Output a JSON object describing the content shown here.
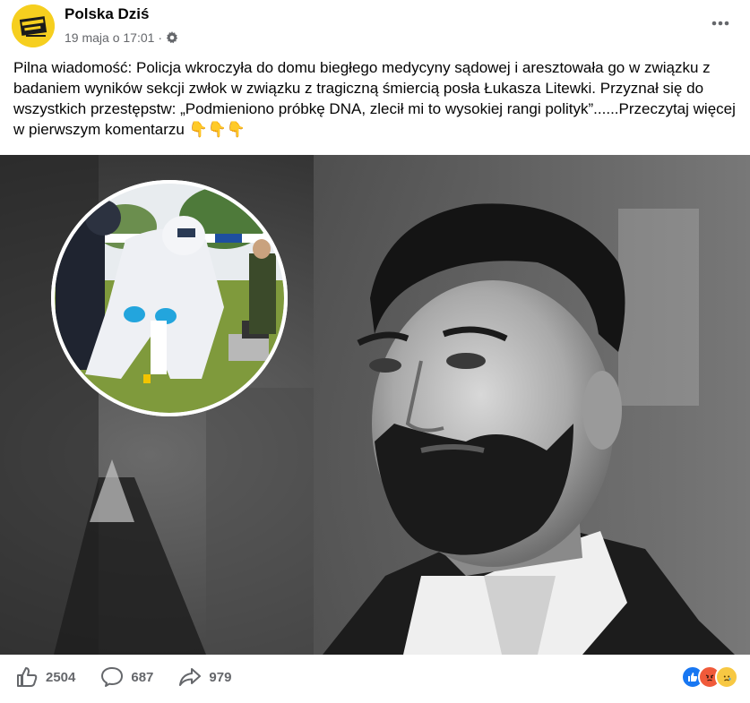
{
  "header": {
    "page_name": "Polska Dziś",
    "timestamp": "19 maja o 17:01",
    "separator": "·",
    "avatar_text": "POLSKA DZIŚ"
  },
  "post": {
    "text": "Pilna wiadomość: Policja wkroczyła do domu biegłego medycyny sądowej i aresztowała go w związku z badaniem wyników sekcji zwłok w związku z tragiczną śmiercią posła Łukasza Litewki. Przyznał się do wszystkich przestępstw: „Podmieniono próbkę DNA, zlecił mi to wysokiej rangi polityk”......Przeczytaj więcej w pierwszym komentarzu 👇👇👇"
  },
  "engagement": {
    "likes": "2504",
    "comments": "687",
    "shares": "979"
  },
  "colors": {
    "accent": "#1877f2",
    "meta_text": "#65676b",
    "avatar_bg": "#f6cf1f",
    "angry": "#f05a3a",
    "sad": "#f7c843"
  },
  "icons": {
    "privacy": "gear-icon",
    "more": "more-icon",
    "like": "thumbs-up-icon",
    "comment": "comment-icon",
    "share": "share-icon"
  }
}
